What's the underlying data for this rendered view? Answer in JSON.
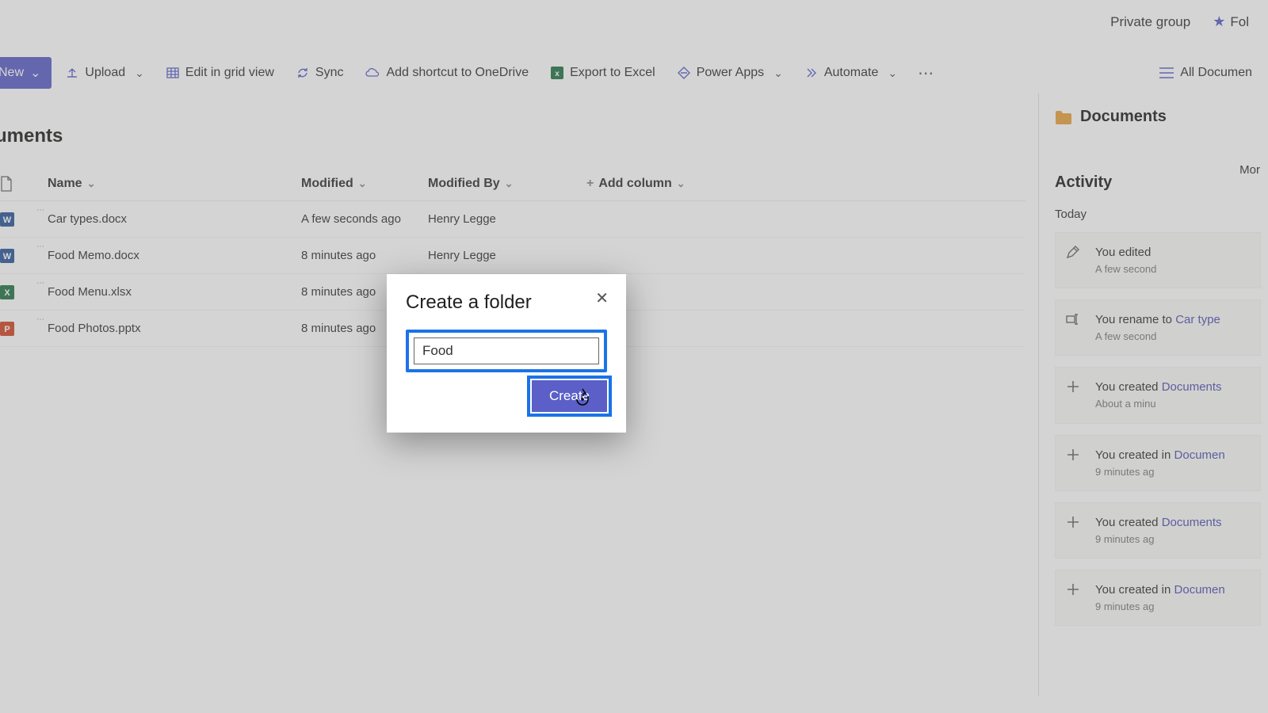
{
  "header": {
    "privateGroup": "Private group",
    "follow": "Fol"
  },
  "commandBar": {
    "new": "New",
    "upload": "Upload",
    "editGrid": "Edit in grid view",
    "sync": "Sync",
    "shortcut": "Add shortcut to OneDrive",
    "export": "Export to Excel",
    "powerApps": "Power Apps",
    "automate": "Automate",
    "viewName": "All Documen"
  },
  "library": {
    "title": "uments"
  },
  "columns": {
    "name": "Name",
    "modified": "Modified",
    "modifiedBy": "Modified By",
    "addColumn": "Add column"
  },
  "files": [
    {
      "type": "word",
      "name": "Car types.docx",
      "modified": "A few seconds ago",
      "by": "Henry Legge"
    },
    {
      "type": "word",
      "name": "Food Memo.docx",
      "modified": "8 minutes ago",
      "by": "Henry Legge"
    },
    {
      "type": "excel",
      "name": "Food Menu.xlsx",
      "modified": "8 minutes ago",
      "by": ""
    },
    {
      "type": "ppt",
      "name": "Food Photos.pptx",
      "modified": "8 minutes ago",
      "by": ""
    }
  ],
  "rightPanel": {
    "title": "Documents",
    "more": "Mor",
    "activityHeading": "Activity",
    "today": "Today",
    "items": [
      {
        "icon": "edit",
        "text": "You edited",
        "link": "",
        "time": "A few second"
      },
      {
        "icon": "rename",
        "text": "You rename to ",
        "link": "Car type",
        "time": "A few second"
      },
      {
        "icon": "plus",
        "text": "You created ",
        "link": "Documents",
        "time": "About a minu"
      },
      {
        "icon": "plus",
        "text": "You created in ",
        "link": "Documen",
        "time": "9 minutes ag"
      },
      {
        "icon": "plus",
        "text": "You created ",
        "link": "Documents",
        "time": "9 minutes ag"
      },
      {
        "icon": "plus",
        "text": "You created in ",
        "link": "Documen",
        "time": "9 minutes ag"
      }
    ]
  },
  "dialog": {
    "title": "Create a folder",
    "value": "Food",
    "createLabel": "Create"
  },
  "icons": {
    "word": {
      "bg": "#2b579a",
      "letter": "W"
    },
    "excel": {
      "bg": "#217346",
      "letter": "X"
    },
    "ppt": {
      "bg": "#d24726",
      "letter": "P"
    }
  }
}
